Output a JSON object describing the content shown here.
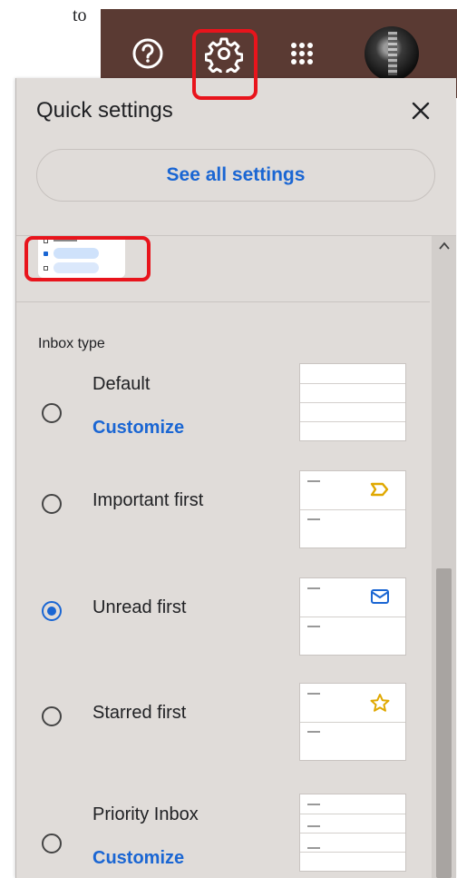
{
  "doc": {
    "fragment": "to"
  },
  "topbar": {
    "bg": "#5a3a33",
    "icons": [
      "help-icon",
      "settings-gear-icon",
      "apps-grid-icon",
      "account-avatar"
    ]
  },
  "highlight_color": "#e8141c",
  "quick_settings": {
    "title": "Quick settings",
    "close_icon": "close-icon",
    "see_all_label": "See all settings",
    "accent": "#1a66d3",
    "section_title": "Inbox type",
    "options": [
      {
        "label": "Default",
        "customize": "Customize",
        "selected": false,
        "preview_icon": "none"
      },
      {
        "label": "Important first",
        "customize": "",
        "selected": false,
        "preview_icon": "important-marker-icon"
      },
      {
        "label": "Unread first",
        "customize": "",
        "selected": true,
        "preview_icon": "envelope-icon"
      },
      {
        "label": "Starred first",
        "customize": "",
        "selected": false,
        "preview_icon": "star-icon"
      },
      {
        "label": "Priority Inbox",
        "customize": "Customize",
        "selected": false,
        "preview_icon": "none"
      }
    ]
  }
}
